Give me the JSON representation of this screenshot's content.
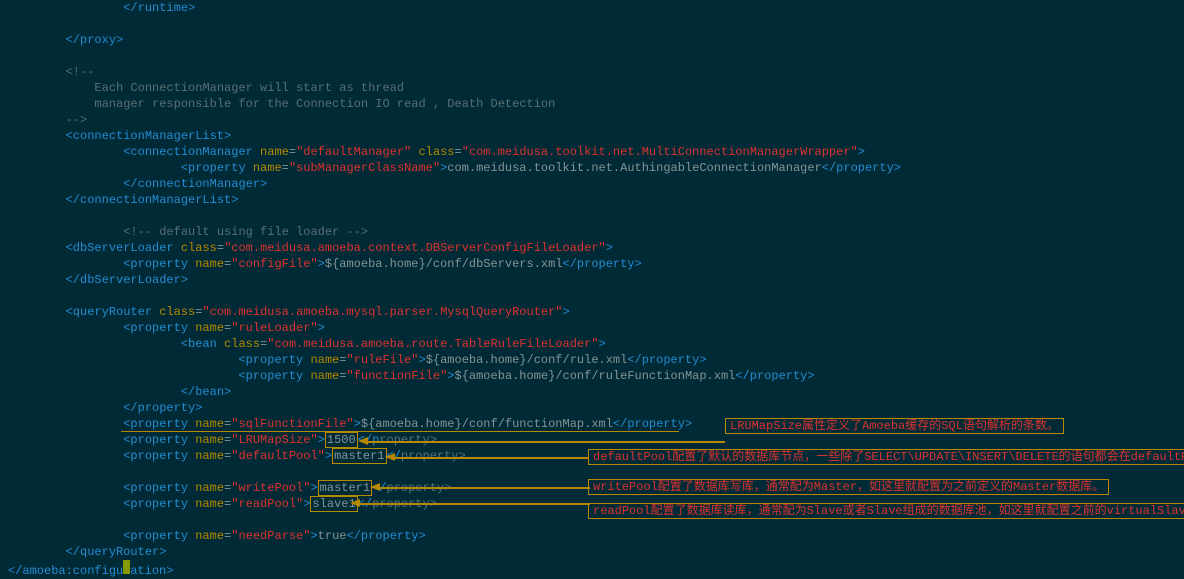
{
  "code_lines": [
    {
      "indent": 16,
      "html": "<span class='tag'>&lt;/runtime&gt;</span>"
    },
    {
      "indent": 0,
      "html": ""
    },
    {
      "indent": 8,
      "html": "<span class='tag'>&lt;/proxy&gt;</span>"
    },
    {
      "indent": 0,
      "html": ""
    },
    {
      "indent": 8,
      "html": "<span class='comment'>&lt;!--</span>"
    },
    {
      "indent": 12,
      "html": "<span class='comment'>Each ConnectionManager will start as thread</span>"
    },
    {
      "indent": 12,
      "html": "<span class='comment'>manager responsible for the Connection IO read , Death Detection</span>"
    },
    {
      "indent": 8,
      "html": "<span class='comment'>--&gt;</span>"
    },
    {
      "indent": 8,
      "html": "<span class='tag'>&lt;connectionManagerList&gt;</span>"
    },
    {
      "indent": 16,
      "html": "<span class='tag'>&lt;connectionManager</span> <span class='attr'>name</span><span class='attr-eq'>=</span><span class='str'>\"defaultManager\"</span> <span class='attr'>class</span><span class='attr-eq'>=</span><span class='str'>\"com.meidusa.toolkit.net.MultiConnectionManagerWrapper\"</span><span class='tag'>&gt;</span>"
    },
    {
      "indent": 24,
      "html": "<span class='tag'>&lt;property</span> <span class='attr'>name</span><span class='attr-eq'>=</span><span class='str'>\"subManagerClassName\"</span><span class='tag'>&gt;</span><span class='txt'>com.meidusa.toolkit.net.AuthingableConnectionManager</span><span class='tag'>&lt;/property&gt;</span>"
    },
    {
      "indent": 16,
      "html": "<span class='tag'>&lt;/connectionManager&gt;</span>"
    },
    {
      "indent": 8,
      "html": "<span class='tag'>&lt;/connectionManagerList&gt;</span>"
    },
    {
      "indent": 0,
      "html": ""
    },
    {
      "indent": 16,
      "html": "<span class='comment'>&lt;!-- default using file loader --&gt;</span>"
    },
    {
      "indent": 8,
      "html": "<span class='tag'>&lt;dbServerLoader</span> <span class='attr'>class</span><span class='attr-eq'>=</span><span class='str'>\"com.meidusa.amoeba.context.DBServerConfigFileLoader\"</span><span class='tag'>&gt;</span>"
    },
    {
      "indent": 16,
      "html": "<span class='tag'>&lt;property</span> <span class='attr'>name</span><span class='attr-eq'>=</span><span class='str'>\"configFile\"</span><span class='tag'>&gt;</span><span class='txt'>${amoeba.home}/conf/dbServers.xml</span><span class='tag'>&lt;/property&gt;</span>"
    },
    {
      "indent": 8,
      "html": "<span class='tag'>&lt;/dbServerLoader&gt;</span>"
    },
    {
      "indent": 0,
      "html": ""
    },
    {
      "indent": 8,
      "html": "<span class='tag'>&lt;queryRouter</span> <span class='attr'>class</span><span class='attr-eq'>=</span><span class='str'>\"com.meidusa.amoeba.mysql.parser.MysqlQueryRouter\"</span><span class='tag'>&gt;</span>"
    },
    {
      "indent": 16,
      "html": "<span class='tag'>&lt;property</span> <span class='attr'>name</span><span class='attr-eq'>=</span><span class='str'>\"ruleLoader\"</span><span class='tag'>&gt;</span>"
    },
    {
      "indent": 24,
      "html": "<span class='tag'>&lt;bean</span> <span class='attr'>class</span><span class='attr-eq'>=</span><span class='str'>\"com.meidusa.amoeba.route.TableRuleFileLoader\"</span><span class='tag'>&gt;</span>"
    },
    {
      "indent": 32,
      "html": "<span class='tag'>&lt;property</span> <span class='attr'>name</span><span class='attr-eq'>=</span><span class='str'>\"ruleFile\"</span><span class='tag'>&gt;</span><span class='txt'>${amoeba.home}/conf/rule.xml</span><span class='tag'>&lt;/property&gt;</span>"
    },
    {
      "indent": 32,
      "html": "<span class='tag'>&lt;property</span> <span class='attr'>name</span><span class='attr-eq'>=</span><span class='str'>\"functionFile\"</span><span class='tag'>&gt;</span><span class='txt'>${amoeba.home}/conf/ruleFunctionMap.xml</span><span class='tag'>&lt;/property&gt;</span>"
    },
    {
      "indent": 24,
      "html": "<span class='tag'>&lt;/bean&gt;</span>"
    },
    {
      "indent": 16,
      "html": "<span class='tag'>&lt;/property&gt;</span>"
    },
    {
      "indent": 16,
      "html": "<span class='tag'>&lt;property</span> <span class='attr'>name</span><span class='attr-eq'>=</span><span class='str'>\"sqlFunctionFile\"</span><span class='tag'>&gt;</span><span class='txt'>${amoeba.home}/conf/functionMap.xml</span><span class='tag'>&lt;/property&gt;</span>"
    },
    {
      "indent": 16,
      "html": "<span class='tag'>&lt;property</span> <span class='attr'>name</span><span class='attr-eq'>=</span><span class='str'>\"LRUMapSize\"</span><span class='tag'>&gt;</span><span class='txt' style='border:1px solid #b58900;padding:0 1px;'>1500</span><span class='tag'>&lt;/p</span><span class='comment'>roperty&gt;</span>"
    },
    {
      "indent": 16,
      "html": "<span class='tag'>&lt;property</span> <span class='attr'>name</span><span class='attr-eq'>=</span><span class='str'>\"defaultPool\"</span><span class='tag'>&gt;</span><span class='txt' style='border:1px solid #b58900;padding:0 1px;'>master1</span><span class='tag'>&lt;/</span><span class='comment'>property&gt;</span>"
    },
    {
      "indent": 0,
      "html": ""
    },
    {
      "indent": 16,
      "html": "<span class='tag'>&lt;property</span> <span class='attr'>name</span><span class='attr-eq'>=</span><span class='str'>\"writePool\"</span><span class='tag'>&gt;</span><span class='txt' style='border:1px solid #b58900;padding:0 1px;'>master1</span><span class='tag'>&lt;/</span><span class='comment'>property&gt;</span>"
    },
    {
      "indent": 16,
      "html": "<span class='tag'>&lt;property</span> <span class='attr'>name</span><span class='attr-eq'>=</span><span class='str'>\"readPool\"</span><span class='tag'>&gt;</span><span class='txt' style='border:1px solid #b58900;padding:0 1px;'>slave1</span><span class='tag'>&lt;/</span><span class='comment'>property&gt;</span>"
    },
    {
      "indent": 0,
      "html": ""
    },
    {
      "indent": 16,
      "html": "<span class='tag'>&lt;property</span> <span class='attr'>name</span><span class='attr-eq'>=</span><span class='str'>\"needParse\"</span><span class='tag'>&gt;</span><span class='txt'>true</span><span class='tag'>&lt;/property&gt;</span>"
    },
    {
      "indent": 8,
      "html": "<span class='tag'>&lt;/queryRouter&gt;</span>"
    },
    {
      "indent": 0,
      "html": "<span class='tag'>&lt;/amoeba:configu</span><span class='cursor-box'></span><span class='tag'>ation&gt;</span>"
    }
  ],
  "annotations": {
    "a1": "LRUMapSize属性定义了Amoeba缓存的SQL语句解析的条数。",
    "a2": "defaultPool配置了默认的数据库节点，一些除了SELECT\\UPDATE\\INSERT\\DELETE的语句都会在defaultPool执行。",
    "a3": "writePool配置了数据库写库，通常配为Master，如这里就配置为之前定义的Master数据库。",
    "a4": "readPool配置了数据库读库，通常配为Slave或者Slave组成的数据库池，如这里就配置之前的virtualSlave数据库池"
  },
  "lang_hint": "zh：（中文）"
}
